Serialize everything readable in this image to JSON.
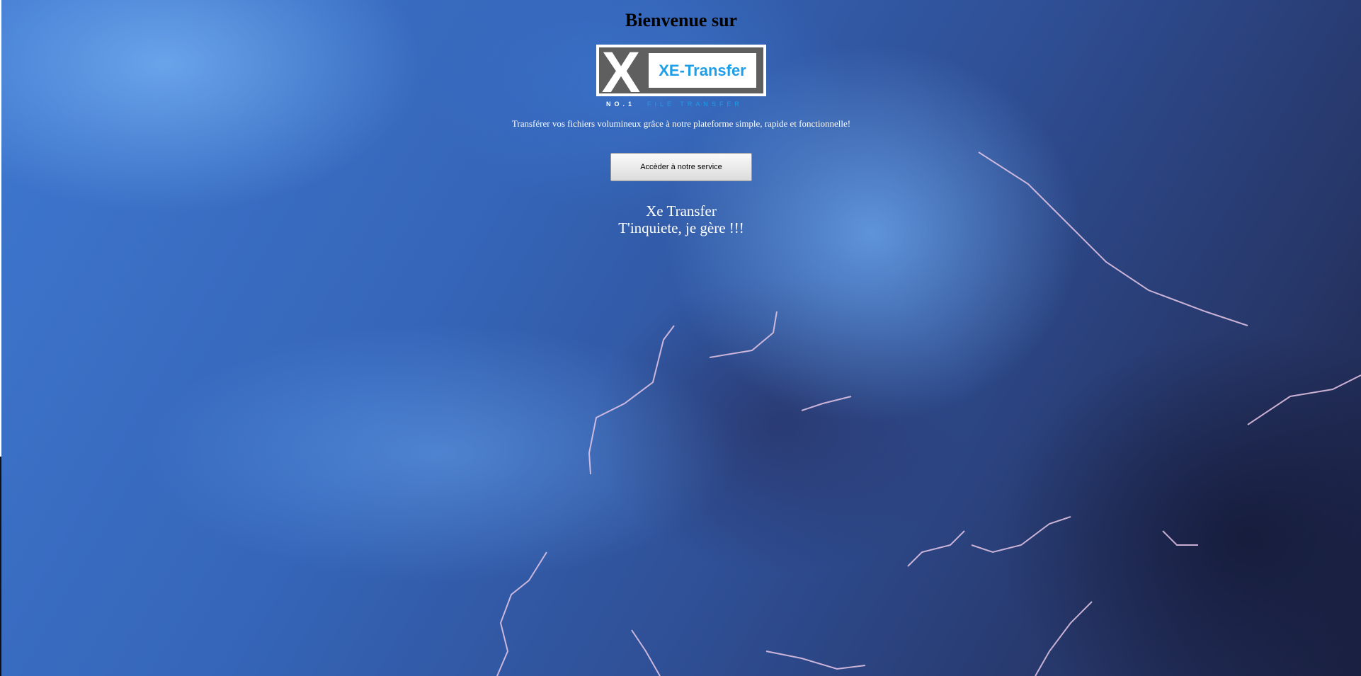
{
  "header": {
    "welcome": "Bienvenue sur"
  },
  "logo": {
    "letter": "X",
    "brand": "XE-Transfer",
    "tagline_prefix": "NO.1",
    "tagline_suffix": "FILE TRANSFER",
    "accent_color": "#1e9de8"
  },
  "main": {
    "tagline": "Transférer vos fichiers volumineux grâce à notre plateforme simple, rapide et fonctionnelle!",
    "cta_label": "Accèder à notre service"
  },
  "footer": {
    "title": "Xe Transfer",
    "slogan": "T'inquiete, je gère !!!"
  },
  "colors": {
    "text_light": "#ffffff",
    "sky_dark": "#1b2142",
    "sky_light": "#3f78d0"
  }
}
